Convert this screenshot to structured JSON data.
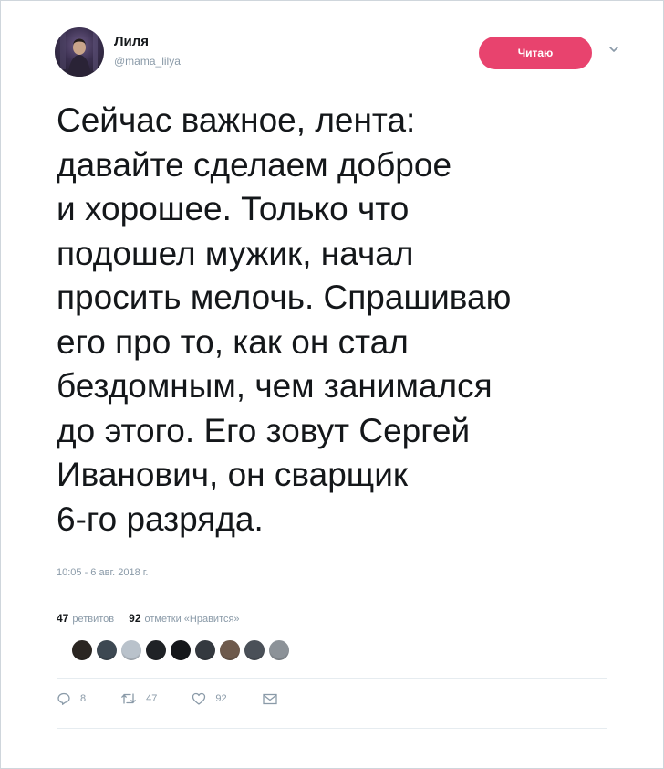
{
  "user": {
    "name": "Лиля",
    "handle": "@mama_lilya"
  },
  "follow_button": {
    "label": "Читаю"
  },
  "tweet": {
    "text": "Сейчас важное, лента:\nдавайте сделаем доброе\nи хорошее. Только что\nподошел мужик, начал\nпросить мелочь. Спрашиваю\nего про то, как он стал\nбездомным, чем занимался\nдо этого. Его зовут Сергей\nИванович, он сварщик\n6-го разряда.",
    "timestamp": "10:05 - 6 авг. 2018 г."
  },
  "stats": {
    "retweets_count": "47",
    "retweets_label": "ретвитов",
    "likes_count": "92",
    "likes_label": "отметки «Нравится»"
  },
  "likers_colors": [
    "#2b2622",
    "#3d4852",
    "#b9c2cb",
    "#1f2226",
    "#15171a",
    "#34393f",
    "#6e5a4c",
    "#4a5058",
    "#8c9298"
  ],
  "actions": {
    "reply_count": "8",
    "retweet_count": "47",
    "like_count": "92"
  },
  "colors": {
    "follow_button": "#e8436e",
    "meta_text": "#8a9aa8"
  }
}
